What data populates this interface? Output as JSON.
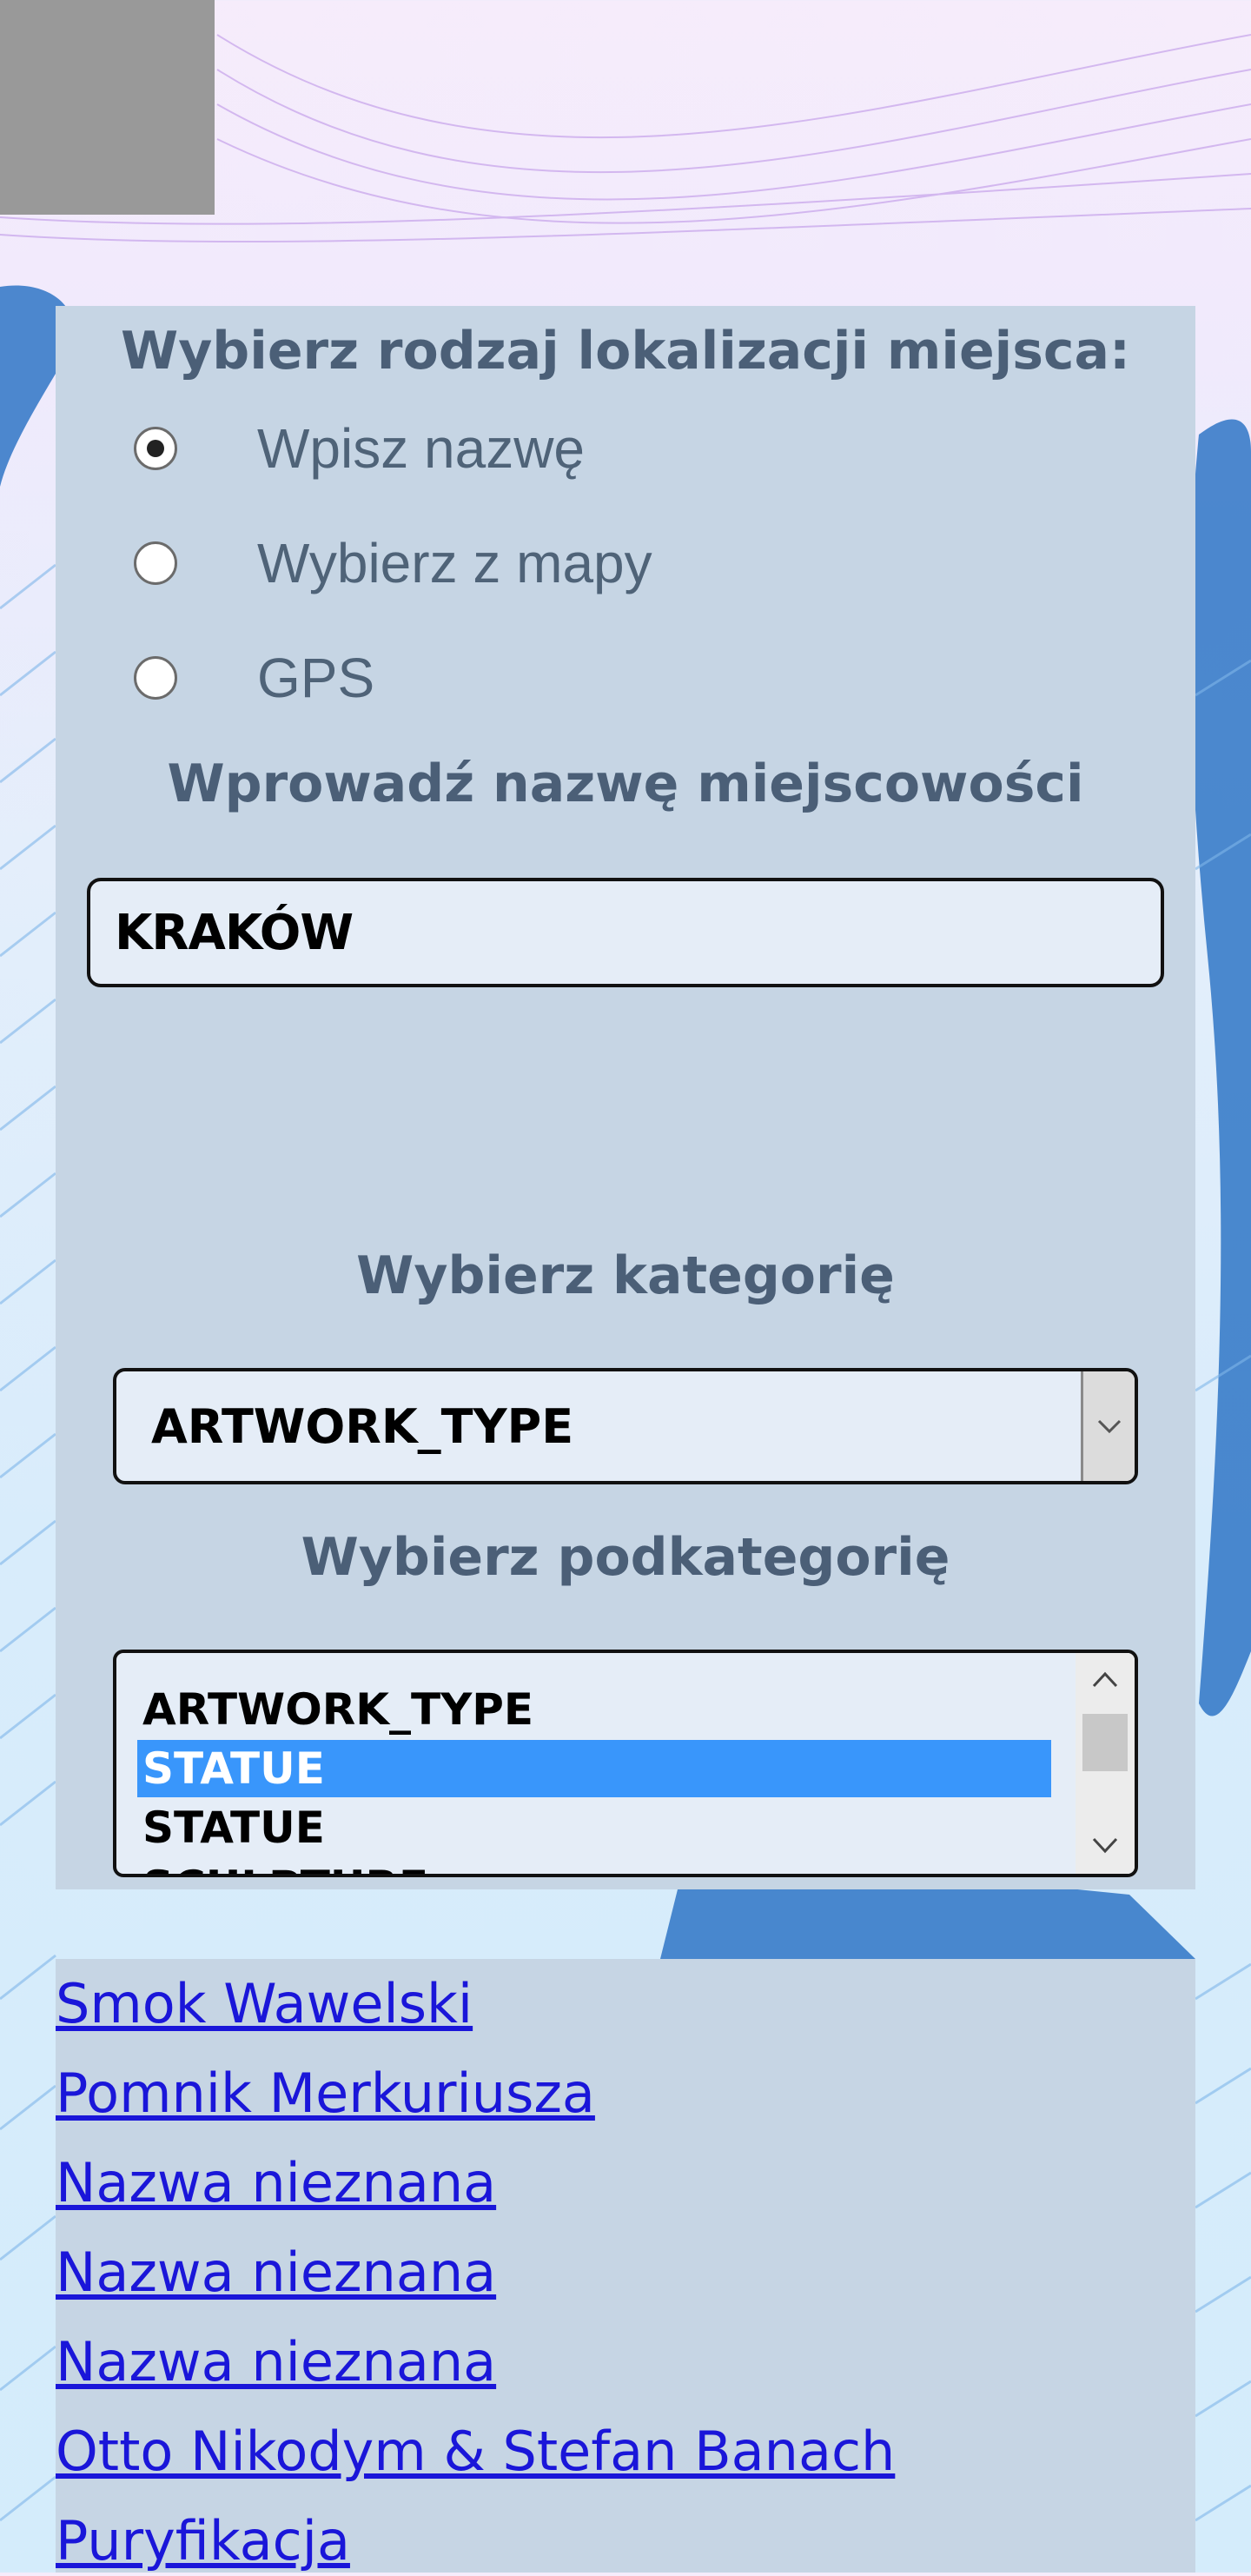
{
  "location_section": {
    "heading": "Wybierz rodzaj lokalizacji miejsca:",
    "options": [
      {
        "label": "Wpisz nazwę",
        "checked": true
      },
      {
        "label": "Wybierz z mapy",
        "checked": false
      },
      {
        "label": "GPS",
        "checked": false
      }
    ]
  },
  "city_section": {
    "heading": "Wprowadź nazwę miejscowości",
    "value": "KRAKÓW"
  },
  "category_section": {
    "heading": "Wybierz kategorię",
    "selected": "ARTWORK_TYPE"
  },
  "subcategory_section": {
    "heading": "Wybierz podkategorię",
    "options": [
      "ARTWORK_TYPE",
      "STATUE",
      "STATUE",
      "SCULPTURE"
    ],
    "selected_index": 1
  },
  "results": [
    "Smok Wawelski",
    "Pomnik Merkuriusza",
    "Nazwa nieznana",
    "Nazwa nieznana",
    "Nazwa nieznana",
    "Otto Nikodym & Stefan Banach",
    "Puryfikacja"
  ],
  "colors": {
    "panel": "#c6d5e4",
    "heading_text": "#4b5f77",
    "link": "#1a16d9",
    "list_selection": "#3996fb"
  }
}
